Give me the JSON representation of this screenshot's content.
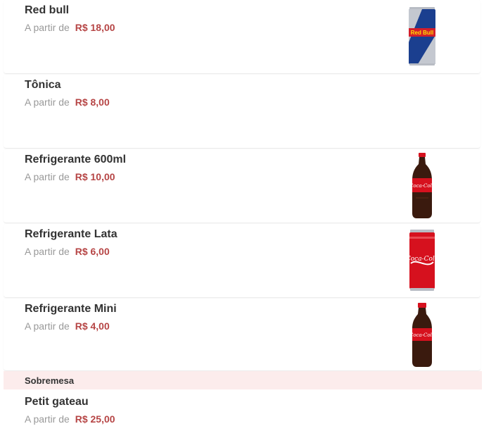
{
  "price_prefix": "A partir de",
  "colors": {
    "price": "#b64545",
    "section_bg": "#fcecec"
  },
  "items": [
    {
      "name": "Red bull",
      "price": "R$ 18,00",
      "image": "red-bull-can"
    },
    {
      "name": "Tônica",
      "price": "R$ 8,00",
      "image": ""
    },
    {
      "name": "Refrigerante 600ml",
      "price": "R$ 10,00",
      "image": "coca-cola-bottle"
    },
    {
      "name": "Refrigerante Lata",
      "price": "R$ 6,00",
      "image": "coca-cola-can"
    },
    {
      "name": "Refrigerante Mini",
      "price": "R$ 4,00",
      "image": "coca-cola-mini-bottle"
    }
  ],
  "section": {
    "title": "Sobremesa"
  },
  "dessert_items": [
    {
      "name": "Petit gateau",
      "price": "R$ 25,00"
    }
  ]
}
